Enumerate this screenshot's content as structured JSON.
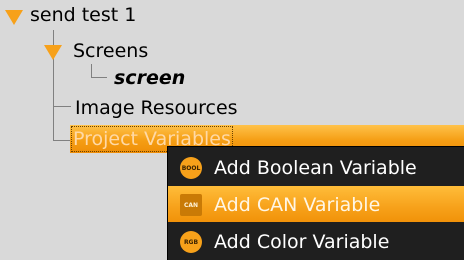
{
  "tree": {
    "project": {
      "label": "send test 1",
      "icon": "expanded-triangle-icon"
    },
    "screens": {
      "label": "Screens",
      "icon": "expanded-triangle-icon"
    },
    "screen": {
      "label": "screen"
    },
    "image_resources": {
      "label": "Image Resources"
    },
    "project_variables": {
      "label": "Project Variables",
      "selected": true
    }
  },
  "context_menu": {
    "items": [
      {
        "label": "Add Boolean Variable",
        "icon_text": "BOOL",
        "icon": "boolean-variable-icon"
      },
      {
        "label": "Add CAN Variable",
        "icon_text": "CAN",
        "icon": "can-variable-icon",
        "active": true
      },
      {
        "label": "Add Color Variable",
        "icon_text": "RGB",
        "icon": "color-variable-icon"
      }
    ]
  },
  "colors": {
    "accent": "#f7a11a",
    "background": "#d9d9d9",
    "menu_background": "#1f1f1f"
  }
}
